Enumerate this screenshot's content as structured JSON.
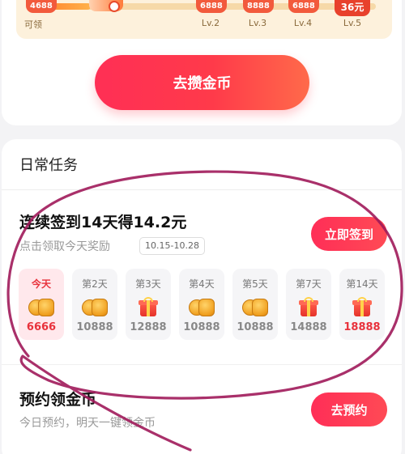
{
  "level_bar": {
    "progress_fraction": 0.17,
    "start": {
      "coins": "4688",
      "label": "可领"
    },
    "levels": [
      {
        "coins": "6888",
        "label": "Lv.2"
      },
      {
        "coins": "8888",
        "label": "Lv.3"
      },
      {
        "coins": "6888",
        "label": "Lv.4"
      },
      {
        "coins": "36元",
        "label": "Lv.5"
      }
    ]
  },
  "collect_button": {
    "label": "去攒金币"
  },
  "daily_tasks": {
    "title": "日常任务",
    "checkin": {
      "title": "连续签到14天得14.2元",
      "subtitle": "点击领取今天奖励",
      "date_range": "10.15-10.28",
      "button": "立即签到",
      "days": [
        {
          "label": "今天",
          "icon": "coin-icon",
          "amount": "6666"
        },
        {
          "label": "第2天",
          "icon": "coin-icon",
          "amount": "10888"
        },
        {
          "label": "第3天",
          "icon": "gift-icon",
          "amount": "12888"
        },
        {
          "label": "第4天",
          "icon": "coin-icon",
          "amount": "10888"
        },
        {
          "label": "第5天",
          "icon": "coin-icon",
          "amount": "10888"
        },
        {
          "label": "第7天",
          "icon": "gift-icon",
          "amount": "14888"
        },
        {
          "label": "第14天",
          "icon": "gift-icon",
          "amount": "18888"
        }
      ]
    },
    "reserve": {
      "title": "预约领金币",
      "subtitle": "今日预约，明天一键领金币",
      "button": "去预约"
    }
  },
  "colors": {
    "accent": "#ff2f55",
    "highlight_red": "#e8323c",
    "annotation_stroke": "#a01a5a"
  }
}
